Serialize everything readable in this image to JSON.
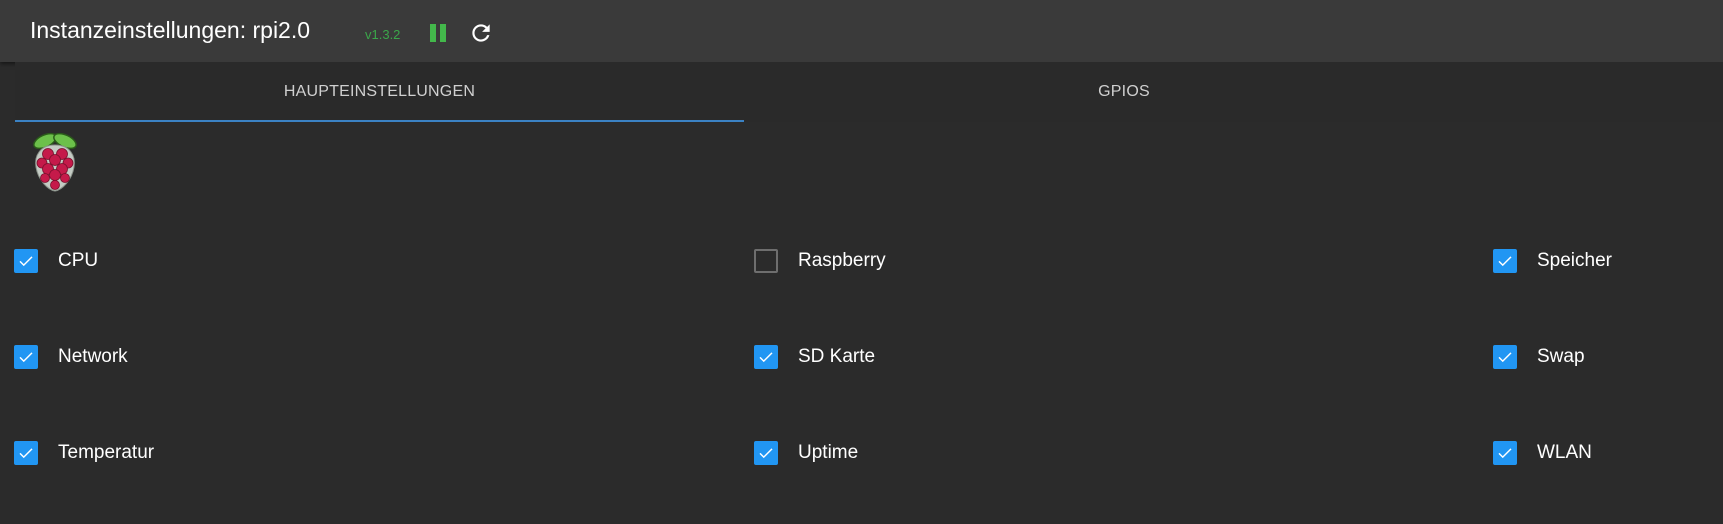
{
  "header": {
    "title": "Instanzeinstellungen: rpi2.0",
    "version": "v1.3.2",
    "accent_color": "#43b84b"
  },
  "tabs": [
    {
      "label": "HAUPTEINSTELLUNGEN",
      "active": true
    },
    {
      "label": "GPIOS",
      "active": false
    }
  ],
  "logo": {
    "icon": "raspberry-pi-logo-icon"
  },
  "options": [
    {
      "label": "CPU",
      "checked": true
    },
    {
      "label": "Raspberry",
      "checked": false
    },
    {
      "label": "Speicher",
      "checked": true
    },
    {
      "label": "Network",
      "checked": true
    },
    {
      "label": "SD Karte",
      "checked": true
    },
    {
      "label": "Swap",
      "checked": true
    },
    {
      "label": "Temperatur",
      "checked": true
    },
    {
      "label": "Uptime",
      "checked": true
    },
    {
      "label": "WLAN",
      "checked": true
    }
  ],
  "colors": {
    "checkbox_checked": "#2196f3",
    "tab_indicator": "#3b82c4",
    "background": "#2b2b2b"
  }
}
